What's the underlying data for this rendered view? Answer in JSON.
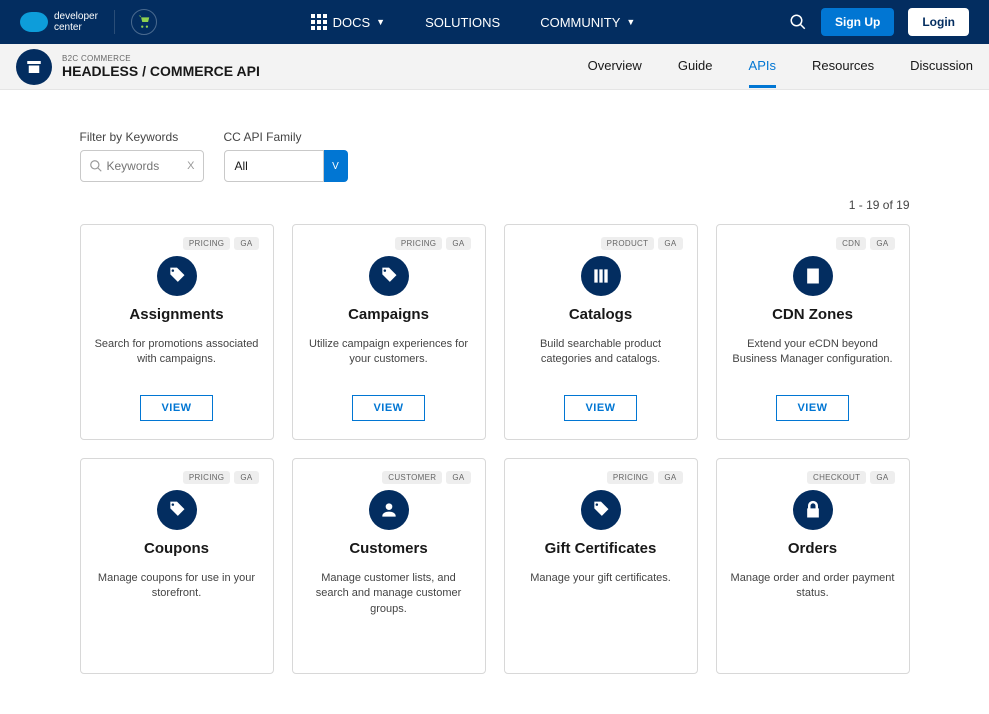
{
  "nav": {
    "logo_top": "developer",
    "logo_bottom": "center",
    "docs": "DOCS",
    "solutions": "SOLUTIONS",
    "community": "COMMUNITY",
    "signup": "Sign Up",
    "login": "Login"
  },
  "subheader": {
    "crumb": "B2C COMMERCE",
    "title": "HEADLESS / COMMERCE API",
    "tabs": [
      "Overview",
      "Guide",
      "APIs",
      "Resources",
      "Discussion"
    ]
  },
  "filters": {
    "keywords_label": "Filter by Keywords",
    "keywords_placeholder": "Keywords",
    "clear": "X",
    "family_label": "CC API Family",
    "family_value": "All",
    "dropdown_chevron": "V"
  },
  "count": "1 - 19 of 19",
  "view_label": "VIEW",
  "cards": [
    {
      "badges": [
        "PRICING",
        "GA"
      ],
      "title": "Assignments",
      "desc": "Search for promotions associated with campaigns.",
      "icon": "tag"
    },
    {
      "badges": [
        "PRICING",
        "GA"
      ],
      "title": "Campaigns",
      "desc": "Utilize campaign experiences for your customers.",
      "icon": "tag"
    },
    {
      "badges": [
        "PRODUCT",
        "GA"
      ],
      "title": "Catalogs",
      "desc": "Build searchable product categories and catalogs.",
      "icon": "columns"
    },
    {
      "badges": [
        "CDN",
        "GA"
      ],
      "title": "CDN Zones",
      "desc": "Extend your eCDN beyond Business Manager configuration.",
      "icon": "building"
    },
    {
      "badges": [
        "PRICING",
        "GA"
      ],
      "title": "Coupons",
      "desc": "Manage coupons for use in your storefront.",
      "icon": "tag"
    },
    {
      "badges": [
        "CUSTOMER",
        "GA"
      ],
      "title": "Customers",
      "desc": "Manage customer lists, and search and manage customer groups.",
      "icon": "users"
    },
    {
      "badges": [
        "PRICING",
        "GA"
      ],
      "title": "Gift Certificates",
      "desc": "Manage your gift certificates.",
      "icon": "tag"
    },
    {
      "badges": [
        "CHECKOUT",
        "GA"
      ],
      "title": "Orders",
      "desc": "Manage order and order payment status.",
      "icon": "lock"
    }
  ]
}
